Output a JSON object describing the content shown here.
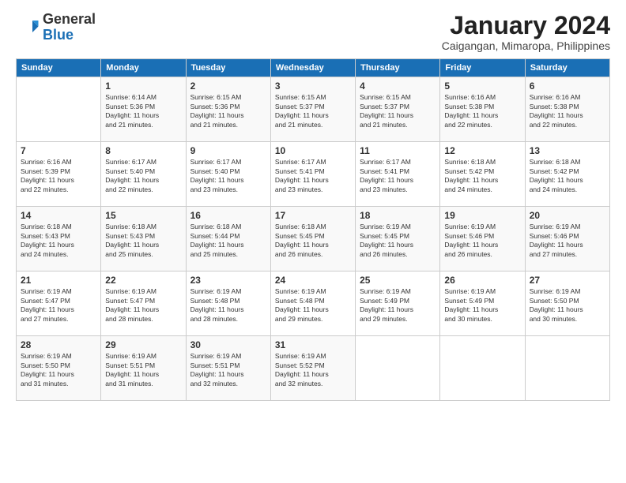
{
  "header": {
    "logo_general": "General",
    "logo_blue": "Blue",
    "month": "January 2024",
    "location": "Caigangan, Mimaropa, Philippines"
  },
  "weekdays": [
    "Sunday",
    "Monday",
    "Tuesday",
    "Wednesday",
    "Thursday",
    "Friday",
    "Saturday"
  ],
  "weeks": [
    [
      {
        "day": "",
        "info": ""
      },
      {
        "day": "1",
        "info": "Sunrise: 6:14 AM\nSunset: 5:36 PM\nDaylight: 11 hours\nand 21 minutes."
      },
      {
        "day": "2",
        "info": "Sunrise: 6:15 AM\nSunset: 5:36 PM\nDaylight: 11 hours\nand 21 minutes."
      },
      {
        "day": "3",
        "info": "Sunrise: 6:15 AM\nSunset: 5:37 PM\nDaylight: 11 hours\nand 21 minutes."
      },
      {
        "day": "4",
        "info": "Sunrise: 6:15 AM\nSunset: 5:37 PM\nDaylight: 11 hours\nand 21 minutes."
      },
      {
        "day": "5",
        "info": "Sunrise: 6:16 AM\nSunset: 5:38 PM\nDaylight: 11 hours\nand 22 minutes."
      },
      {
        "day": "6",
        "info": "Sunrise: 6:16 AM\nSunset: 5:38 PM\nDaylight: 11 hours\nand 22 minutes."
      }
    ],
    [
      {
        "day": "7",
        "info": "Sunrise: 6:16 AM\nSunset: 5:39 PM\nDaylight: 11 hours\nand 22 minutes."
      },
      {
        "day": "8",
        "info": "Sunrise: 6:17 AM\nSunset: 5:40 PM\nDaylight: 11 hours\nand 22 minutes."
      },
      {
        "day": "9",
        "info": "Sunrise: 6:17 AM\nSunset: 5:40 PM\nDaylight: 11 hours\nand 23 minutes."
      },
      {
        "day": "10",
        "info": "Sunrise: 6:17 AM\nSunset: 5:41 PM\nDaylight: 11 hours\nand 23 minutes."
      },
      {
        "day": "11",
        "info": "Sunrise: 6:17 AM\nSunset: 5:41 PM\nDaylight: 11 hours\nand 23 minutes."
      },
      {
        "day": "12",
        "info": "Sunrise: 6:18 AM\nSunset: 5:42 PM\nDaylight: 11 hours\nand 24 minutes."
      },
      {
        "day": "13",
        "info": "Sunrise: 6:18 AM\nSunset: 5:42 PM\nDaylight: 11 hours\nand 24 minutes."
      }
    ],
    [
      {
        "day": "14",
        "info": "Sunrise: 6:18 AM\nSunset: 5:43 PM\nDaylight: 11 hours\nand 24 minutes."
      },
      {
        "day": "15",
        "info": "Sunrise: 6:18 AM\nSunset: 5:43 PM\nDaylight: 11 hours\nand 25 minutes."
      },
      {
        "day": "16",
        "info": "Sunrise: 6:18 AM\nSunset: 5:44 PM\nDaylight: 11 hours\nand 25 minutes."
      },
      {
        "day": "17",
        "info": "Sunrise: 6:18 AM\nSunset: 5:45 PM\nDaylight: 11 hours\nand 26 minutes."
      },
      {
        "day": "18",
        "info": "Sunrise: 6:19 AM\nSunset: 5:45 PM\nDaylight: 11 hours\nand 26 minutes."
      },
      {
        "day": "19",
        "info": "Sunrise: 6:19 AM\nSunset: 5:46 PM\nDaylight: 11 hours\nand 26 minutes."
      },
      {
        "day": "20",
        "info": "Sunrise: 6:19 AM\nSunset: 5:46 PM\nDaylight: 11 hours\nand 27 minutes."
      }
    ],
    [
      {
        "day": "21",
        "info": "Sunrise: 6:19 AM\nSunset: 5:47 PM\nDaylight: 11 hours\nand 27 minutes."
      },
      {
        "day": "22",
        "info": "Sunrise: 6:19 AM\nSunset: 5:47 PM\nDaylight: 11 hours\nand 28 minutes."
      },
      {
        "day": "23",
        "info": "Sunrise: 6:19 AM\nSunset: 5:48 PM\nDaylight: 11 hours\nand 28 minutes."
      },
      {
        "day": "24",
        "info": "Sunrise: 6:19 AM\nSunset: 5:48 PM\nDaylight: 11 hours\nand 29 minutes."
      },
      {
        "day": "25",
        "info": "Sunrise: 6:19 AM\nSunset: 5:49 PM\nDaylight: 11 hours\nand 29 minutes."
      },
      {
        "day": "26",
        "info": "Sunrise: 6:19 AM\nSunset: 5:49 PM\nDaylight: 11 hours\nand 30 minutes."
      },
      {
        "day": "27",
        "info": "Sunrise: 6:19 AM\nSunset: 5:50 PM\nDaylight: 11 hours\nand 30 minutes."
      }
    ],
    [
      {
        "day": "28",
        "info": "Sunrise: 6:19 AM\nSunset: 5:50 PM\nDaylight: 11 hours\nand 31 minutes."
      },
      {
        "day": "29",
        "info": "Sunrise: 6:19 AM\nSunset: 5:51 PM\nDaylight: 11 hours\nand 31 minutes."
      },
      {
        "day": "30",
        "info": "Sunrise: 6:19 AM\nSunset: 5:51 PM\nDaylight: 11 hours\nand 32 minutes."
      },
      {
        "day": "31",
        "info": "Sunrise: 6:19 AM\nSunset: 5:52 PM\nDaylight: 11 hours\nand 32 minutes."
      },
      {
        "day": "",
        "info": ""
      },
      {
        "day": "",
        "info": ""
      },
      {
        "day": "",
        "info": ""
      }
    ]
  ]
}
